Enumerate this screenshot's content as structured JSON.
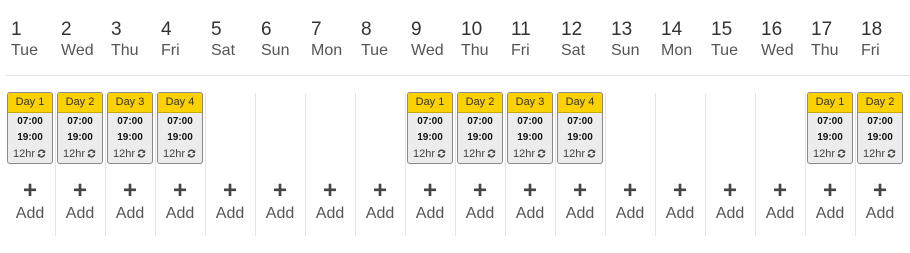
{
  "days": [
    {
      "num": "1",
      "weekday": "Tue",
      "shift": {
        "title": "Day 1",
        "start": "07:00",
        "end": "19:00",
        "duration": "12hr"
      }
    },
    {
      "num": "2",
      "weekday": "Wed",
      "shift": {
        "title": "Day 2",
        "start": "07:00",
        "end": "19:00",
        "duration": "12hr"
      }
    },
    {
      "num": "3",
      "weekday": "Thu",
      "shift": {
        "title": "Day 3",
        "start": "07:00",
        "end": "19:00",
        "duration": "12hr"
      }
    },
    {
      "num": "4",
      "weekday": "Fri",
      "shift": {
        "title": "Day 4",
        "start": "07:00",
        "end": "19:00",
        "duration": "12hr"
      }
    },
    {
      "num": "5",
      "weekday": "Sat",
      "shift": null
    },
    {
      "num": "6",
      "weekday": "Sun",
      "shift": null
    },
    {
      "num": "7",
      "weekday": "Mon",
      "shift": null
    },
    {
      "num": "8",
      "weekday": "Tue",
      "shift": null
    },
    {
      "num": "9",
      "weekday": "Wed",
      "shift": {
        "title": "Day 1",
        "start": "07:00",
        "end": "19:00",
        "duration": "12hr"
      }
    },
    {
      "num": "10",
      "weekday": "Thu",
      "shift": {
        "title": "Day 2",
        "start": "07:00",
        "end": "19:00",
        "duration": "12hr"
      }
    },
    {
      "num": "11",
      "weekday": "Fri",
      "shift": {
        "title": "Day 3",
        "start": "07:00",
        "end": "19:00",
        "duration": "12hr"
      }
    },
    {
      "num": "12",
      "weekday": "Sat",
      "shift": {
        "title": "Day 4",
        "start": "07:00",
        "end": "19:00",
        "duration": "12hr"
      }
    },
    {
      "num": "13",
      "weekday": "Sun",
      "shift": null
    },
    {
      "num": "14",
      "weekday": "Mon",
      "shift": null
    },
    {
      "num": "15",
      "weekday": "Tue",
      "shift": null
    },
    {
      "num": "16",
      "weekday": "Wed",
      "shift": null
    },
    {
      "num": "17",
      "weekday": "Thu",
      "shift": {
        "title": "Day 1",
        "start": "07:00",
        "end": "19:00",
        "duration": "12hr"
      }
    },
    {
      "num": "18",
      "weekday": "Fri",
      "shift": {
        "title": "Day 2",
        "start": "07:00",
        "end": "19:00",
        "duration": "12hr"
      }
    }
  ],
  "add_label": "Add",
  "add_symbol": "+",
  "colors": {
    "shift_header": "#fbd100",
    "shift_body": "#ececec",
    "border": "#8a8a8a"
  },
  "icons": {
    "repeat": "repeat-icon",
    "add": "plus-icon"
  }
}
